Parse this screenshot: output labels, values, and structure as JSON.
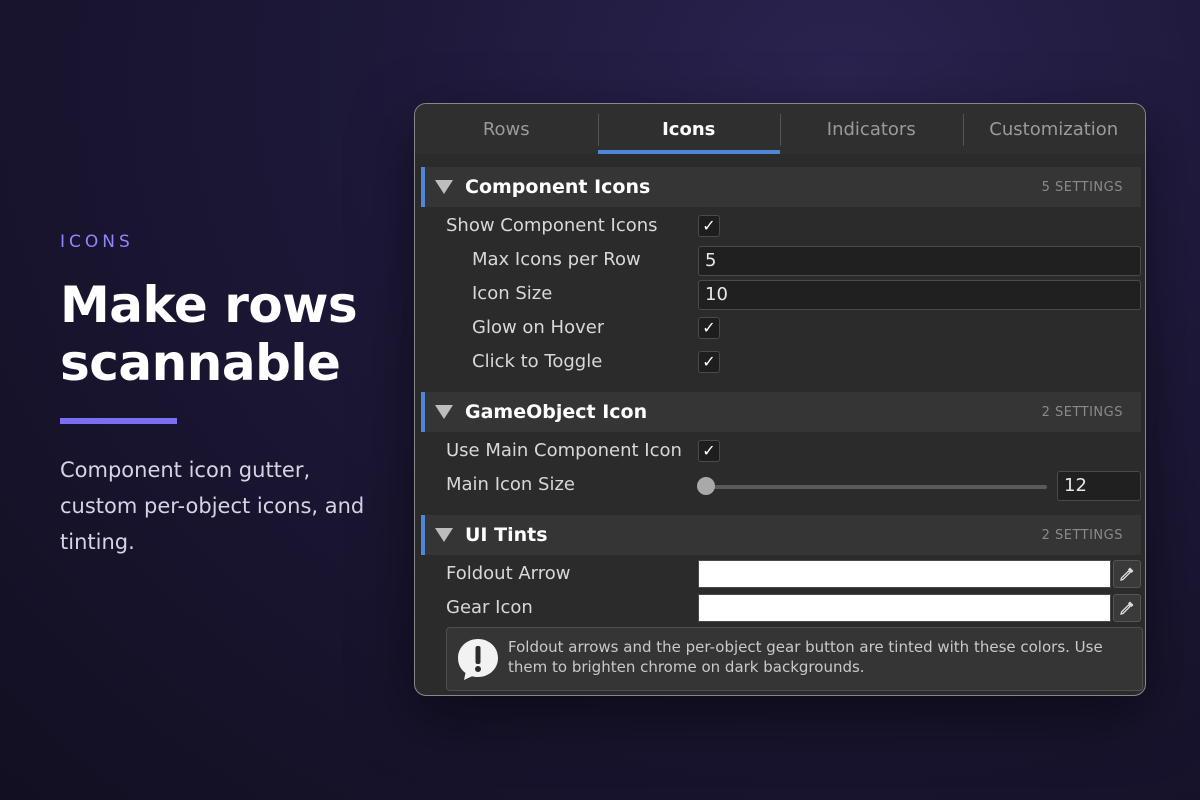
{
  "hero": {
    "eyebrow": "ICONS",
    "headline_line1": "Make rows",
    "headline_line2": "scannable",
    "description": "Component icon gutter, custom per-object icons, and tinting."
  },
  "colors": {
    "accent": "#4f86d6",
    "eyebrow": "#8f86ff",
    "rule": "#7a6ef5"
  },
  "tabs": [
    {
      "label": "Rows",
      "active": false
    },
    {
      "label": "Icons",
      "active": true
    },
    {
      "label": "Indicators",
      "active": false
    },
    {
      "label": "Customization",
      "active": false
    }
  ],
  "sections": {
    "component_icons": {
      "title": "Component Icons",
      "count": "5 SETTINGS",
      "show_label": "Show Component Icons",
      "show_checked": true,
      "max_label": "Max Icons per Row",
      "max_value": "5",
      "size_label": "Icon Size",
      "size_value": "10",
      "glow_label": "Glow on Hover",
      "glow_checked": true,
      "toggle_label": "Click to Toggle",
      "toggle_checked": true
    },
    "gameobject_icon": {
      "title": "GameObject Icon",
      "count": "2 SETTINGS",
      "use_main_label": "Use Main Component Icon",
      "use_main_checked": true,
      "main_size_label": "Main Icon Size",
      "main_size_value": "12"
    },
    "ui_tints": {
      "title": "UI Tints",
      "count": "2 SETTINGS",
      "foldout_label": "Foldout Arrow",
      "foldout_color": "#ffffff",
      "gear_label": "Gear Icon",
      "gear_color": "#ffffff",
      "info_text": "Foldout arrows and the per-object gear button are tinted with these colors. Use them to brighten chrome on dark backgrounds."
    }
  },
  "check_glyph": "✓"
}
